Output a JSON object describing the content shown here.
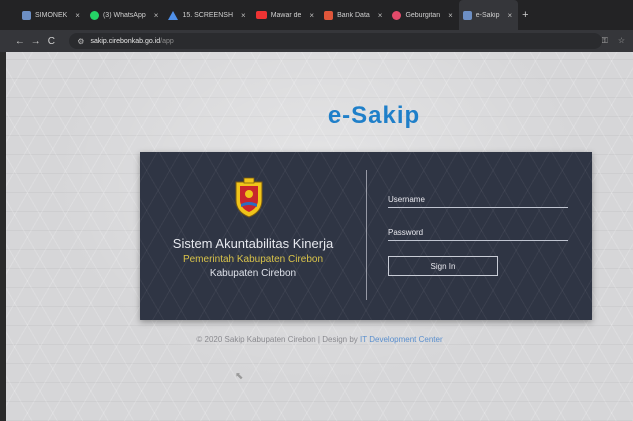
{
  "browser": {
    "tabs": [
      {
        "title": "SIMONEK",
        "icon": "document-icon",
        "color": "#6d8fc4"
      },
      {
        "title": "(3) WhatsApp",
        "icon": "whatsapp-icon",
        "color": "#25d366"
      },
      {
        "title": "15. SCREENSH",
        "icon": "triangle-icon",
        "color": "#4f8fe8"
      },
      {
        "title": "Mawar de",
        "icon": "youtube-icon",
        "color": "#e33"
      },
      {
        "title": "Bank Data",
        "icon": "grid-icon",
        "color": "#e0563a"
      },
      {
        "title": "Geburgitan",
        "icon": "badge-icon",
        "color": "#e24a6a"
      },
      {
        "title": "e-Sakip",
        "icon": "document-icon",
        "color": "#6d8fc4"
      }
    ],
    "new_tab": "+",
    "tab_close": "×",
    "nav": {
      "back": "←",
      "forward": "→",
      "reload": "C"
    },
    "url_host": "sakip.cirebonkab.go.id",
    "url_path": "/app"
  },
  "page": {
    "brand": "e-Sakip",
    "panel": {
      "title": "Sistem Akuntabilitas Kinerja",
      "org": "Pemerintah Kabupaten Cirebon",
      "region": "Kabupaten Cirebon",
      "username_placeholder": "Username",
      "password_placeholder": "Password",
      "signin_label": "Sign In"
    },
    "footer_text": "© 2020 Sakip Kabupaten Cirebon | Design by",
    "footer_link": "IT Development Center"
  },
  "colors": {
    "brand": "#1f7fc9",
    "panel_bg": "#2f3544",
    "org_text": "#d9c34a",
    "link": "#5a8fce"
  }
}
